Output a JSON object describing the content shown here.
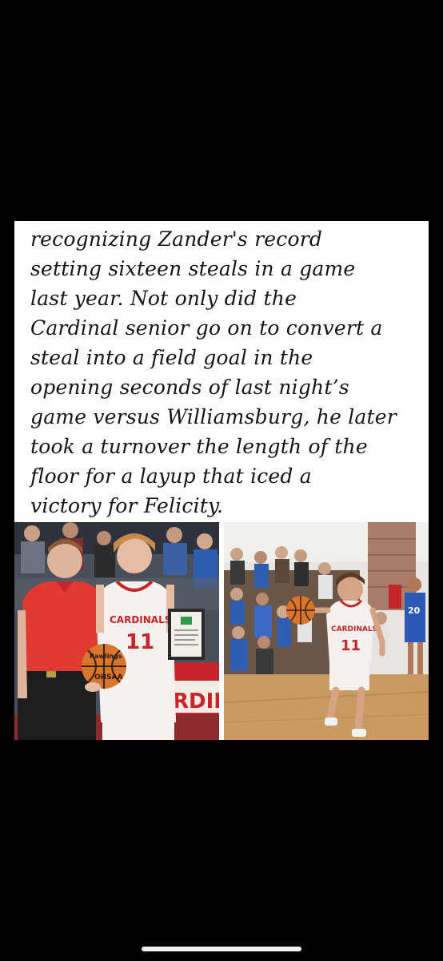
{
  "post": {
    "caption": "recognizing Zander's record\nsetting sixteen steals in a game\nlast year. Not only did the\nCardinal senior go on to convert a\nsteal into a field goal in the\nopening seconds of last night’s\ngame versus Williamsburg, he later\ntook a turnover the length of the\nfloor for a layup that iced a\nvictory for Felicity."
  },
  "photos": {
    "left": {
      "jersey_team": "CARDINALS",
      "jersey_number": "11",
      "ball_brand": "Rawlings",
      "ball_org": "OHSAA",
      "banner_text": "RDINA"
    },
    "right": {
      "jersey_team": "CARDINALS",
      "jersey_number": "11",
      "opponent_number": "20"
    }
  },
  "colors": {
    "cardinal_red": "#c8242b",
    "wildcat_blue": "#2c58b8"
  }
}
